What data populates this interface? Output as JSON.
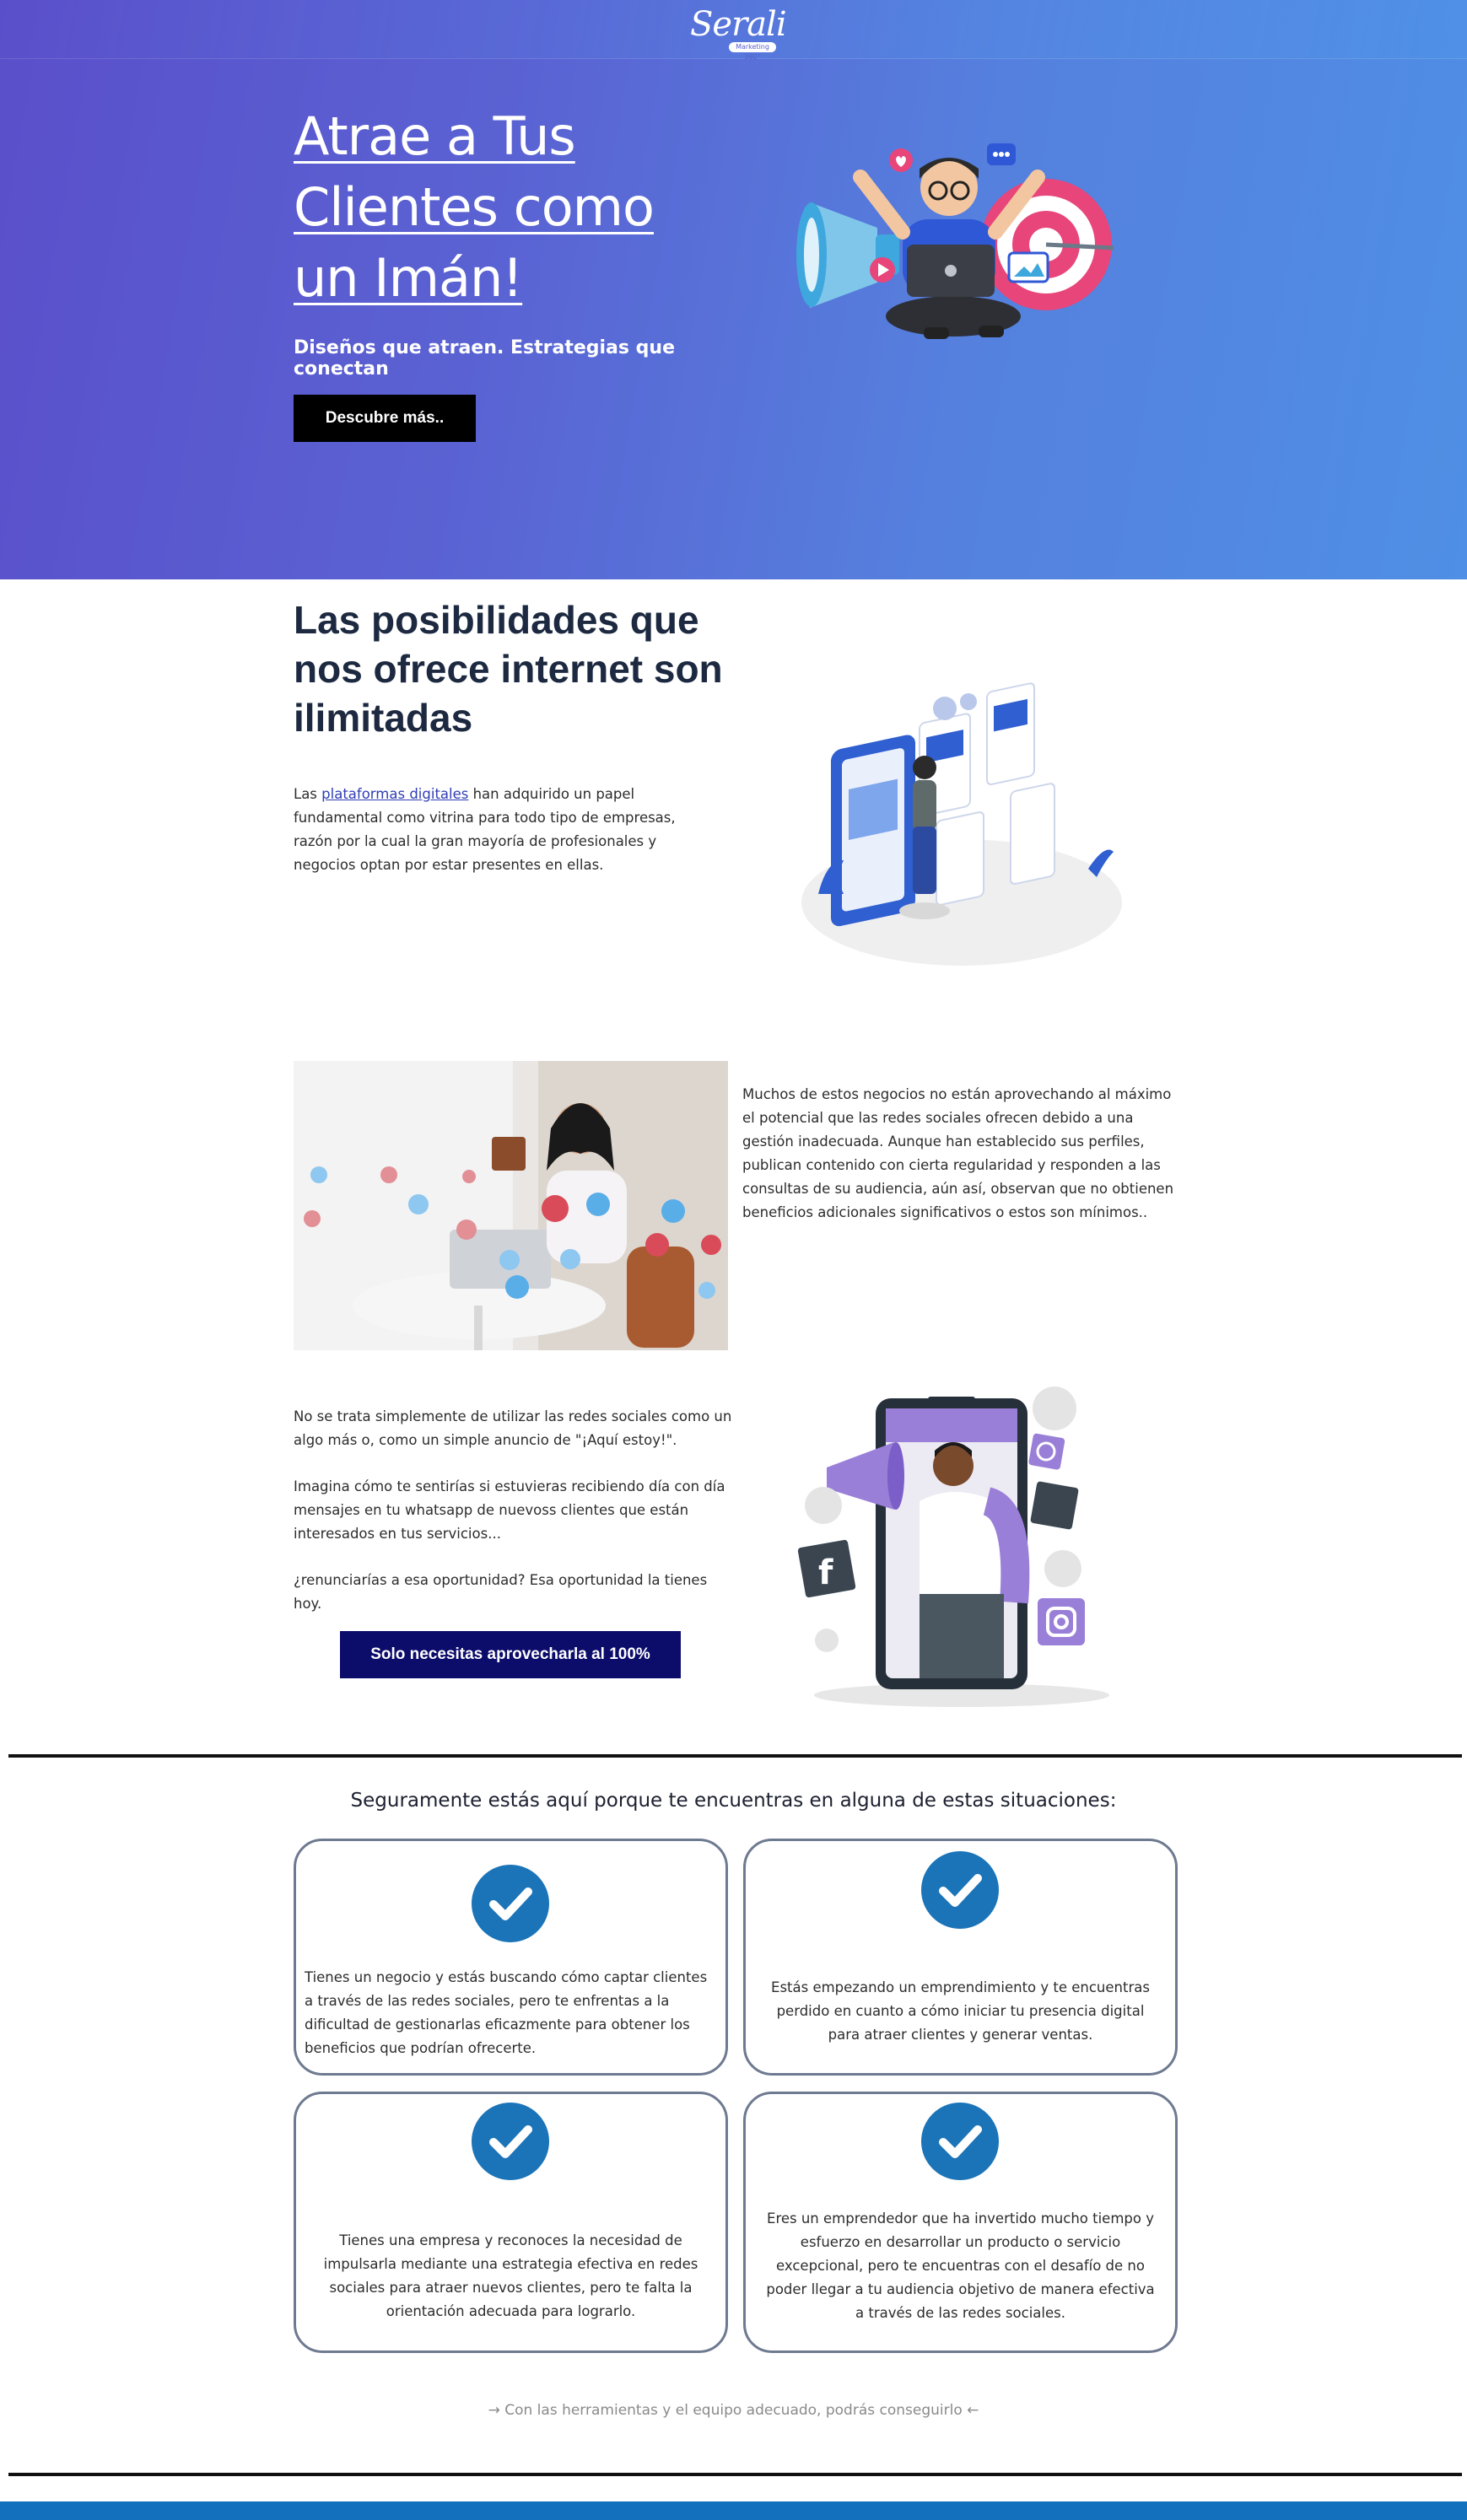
{
  "header": {
    "logo_text": "Serali",
    "logo_tag": "Marketing 360°"
  },
  "hero": {
    "title": "Atrae a Tus Clientes como un Imán!",
    "subtitle": "Diseños que atraen. Estrategias que conectan",
    "cta_label": "Descubre más.."
  },
  "section_internet": {
    "title": "Las posibilidades que nos ofrece internet son ilimitadas",
    "text_before_link": "Las ",
    "link_text": "plataformas digitales",
    "text_after_link": " han adquirido un papel fundamental como vitrina para todo tipo de empresas, razón por la cual la gran mayoría de profesionales y negocios optan por estar presentes en ellas."
  },
  "section_business": {
    "text": "Muchos de estos negocios no están aprovechando al máximo el potencial que las redes sociales ofrecen debido a una gestión inadecuada. Aunque han establecido sus perfiles, publican contenido con cierta regularidad y responden a las consultas de su audiencia, aún así, observan que no obtienen beneficios adicionales significativos o estos son mínimos.."
  },
  "section_opportunity": {
    "paragraphs": [
      "No se trata simplemente de utilizar las redes sociales como un algo más o, como un simple anuncio de \"¡Aquí estoy!\".",
      "Imagina cómo te sentirías si estuvieras recibiendo día con día mensajes en tu whatsapp de nuevoss clientes que están interesados en tus servicios...",
      "¿renunciarías a esa oportunidad? Esa oportunidad la tienes hoy."
    ],
    "cta_label": "Solo necesitas aprovecharla al 100%"
  },
  "situations": {
    "title": "Seguramente estás aquí porque te encuentras en alguna de estas situaciones:",
    "cards": [
      {
        "text": "Tienes un negocio y estás buscando cómo captar clientes a través de las redes sociales, pero te enfrentas a la dificultad de gestionarlas eficazmente para obtener los beneficios que podrían ofrecerte."
      },
      {
        "text": "Estás empezando un emprendimiento y te encuentras perdido en cuanto a cómo iniciar tu presencia digital para atraer clientes y generar ventas."
      },
      {
        "text": "Tienes una empresa y reconoces la necesidad de impulsarla mediante una estrategia efectiva en redes sociales para atraer nuevos clientes, pero te falta la orientación adecuada para lograrlo."
      },
      {
        "text": "Eres un emprendedor que ha invertido mucho tiempo y esfuerzo en desarrollar un producto o servicio excepcional, pero te encuentras con el desafío de no poder llegar a tu audiencia objetivo de manera efectiva a través de las redes sociales."
      }
    ],
    "footnote": "→ Con las herramientas y el equipo adecuado, podrás conseguirlo ←"
  },
  "colors": {
    "hero_start": "#5a4fca",
    "hero_end": "#4f8fe5",
    "check_blue": "#1b74b8",
    "navy_button": "#0c0c6b",
    "heading_dark": "#1c2940",
    "bottom_bar": "#1270bd"
  },
  "icons": [
    "check-icon",
    "megaphone-icon",
    "target-icon",
    "heart-icon",
    "like-icon",
    "facebook-icon",
    "twitter-icon",
    "instagram-icon",
    "whatsapp-icon"
  ]
}
